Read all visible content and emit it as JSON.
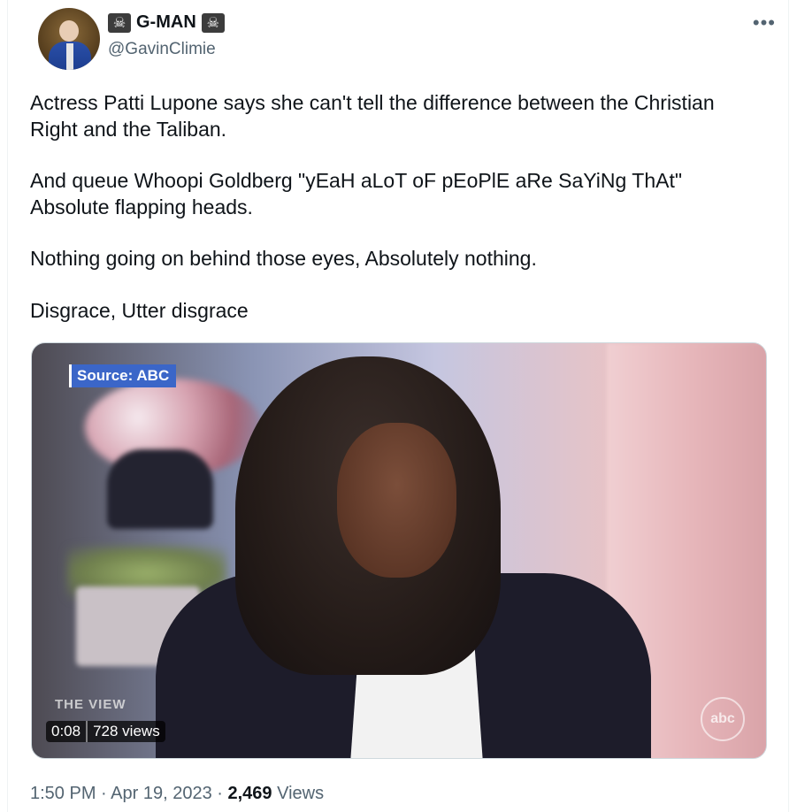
{
  "author": {
    "display_name": "G-MAN",
    "emoji_prefix": "☠",
    "emoji_suffix": "☠",
    "handle": "@GavinClimie"
  },
  "more_icon": "more-horizontal-icon",
  "tweet": {
    "paragraphs": [
      "Actress Patti Lupone says she can't tell the difference between the Christian Right and the Taliban.",
      "And queue Whoopi Goldberg \"yEaH aLoT oF pEoPlE aRe SaYiNg ThAt\" Absolute flapping heads.",
      "Nothing going on behind those eyes, Absolutely nothing.",
      "Disgrace, Utter disgrace"
    ]
  },
  "media": {
    "source_tag": "Source: ABC",
    "show_logo": "THE VIEW",
    "network_logo": "abc",
    "duration": "0:08",
    "views": "728 views"
  },
  "meta": {
    "time": "1:50 PM",
    "separator": "·",
    "date": "Apr 19, 2023",
    "views_count": "2,469",
    "views_label": "Views"
  }
}
